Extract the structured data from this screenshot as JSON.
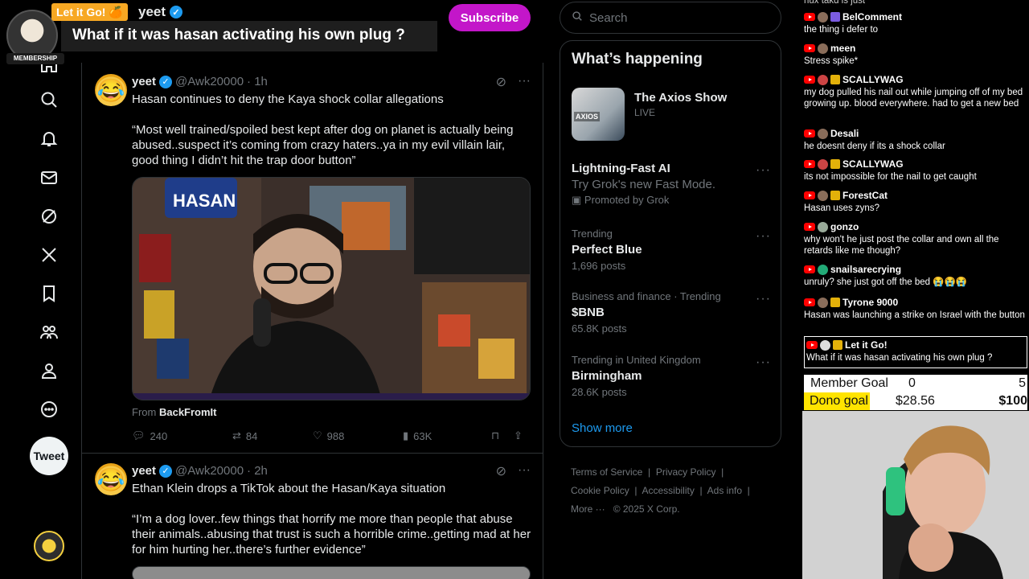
{
  "overlay": {
    "donor_tag": "Let it Go! 🍊",
    "membership_label": "MEMBERSHIP",
    "top_account": "yeet",
    "caption": "What if it was hasan activating his own plug ?",
    "subscribe_label": "Subscribe"
  },
  "nav": {
    "items": [
      "home-icon",
      "explore-icon",
      "notifications-icon",
      "messages-icon",
      "grok-icon",
      "x-premium-icon",
      "bookmarks-icon",
      "communities-icon",
      "profile-icon",
      "more-icon"
    ],
    "tweet_label": "Tweet"
  },
  "feed": {
    "tweets": [
      {
        "name": "yeet",
        "handle": "@Awk20000",
        "time": "· 1h",
        "headline": "Hasan continues to deny the Kaya shock collar allegations",
        "quote": "“Most well trained/spoiled best kept after dog on planet is actually being abused..suspect it’s coming from crazy haters..ya in my evil villain lair, good thing I didn’t hit the trap door button”",
        "from_prefix": "From",
        "from_source": "BackFromIt",
        "replies": "240",
        "retweets": "84",
        "likes": "988",
        "views": "63K",
        "media_sign": "HASAN"
      },
      {
        "name": "yeet",
        "handle": "@Awk20000",
        "time": "· 2h",
        "headline": "Ethan Klein drops a TikTok about the Hasan/Kaya situation",
        "quote": "“I’m a dog lover..few things that horrify me more than people that abuse their animals..abusing that trust is such a horrible crime..getting mad at her for him hurting her..there’s further evidence”"
      }
    ]
  },
  "sidebar": {
    "search_placeholder": "Search",
    "happening_title": "What’s happening",
    "live": {
      "title": "The Axios Show",
      "status": "LIVE",
      "thumb_text": "AXIOS"
    },
    "promo": {
      "title": "Lightning-Fast AI",
      "subtitle": "Try Grok's new Fast Mode.",
      "promoted": "Promoted by Grok"
    },
    "trends": [
      {
        "meta": "Trending",
        "name": "Perfect Blue",
        "posts": "1,696 posts"
      },
      {
        "meta": "Business and finance · Trending",
        "name": "$BNB",
        "posts": "65.8K posts"
      },
      {
        "meta": "Trending in United Kingdom",
        "name": "Birmingham",
        "posts": "28.6K posts"
      }
    ],
    "show_more": "Show more",
    "footer": {
      "terms": "Terms of Service",
      "privacy": "Privacy Policy",
      "cookie": "Cookie Policy",
      "accessibility": "Accessibility",
      "ads": "Ads info",
      "more": "More ···",
      "copyright": "© 2025 X Corp."
    }
  },
  "chat": {
    "top_fragment": "nux takd is just",
    "messages": [
      {
        "user": "BelComment",
        "text": "the thing i defer to"
      },
      {
        "user": "meen",
        "text": "Stress spike*"
      },
      {
        "user": "SCALLYWAG",
        "text": "my dog pulled his nail out while jumping off of my bed growing up. blood everywhere. had to get a new bed"
      },
      {
        "user": "Desali",
        "text": "he doesnt deny if its a shock collar"
      },
      {
        "user": "SCALLYWAG",
        "text": "its not impossible for the nail to get caught"
      },
      {
        "user": "ForestCat",
        "text": "Hasan uses zyns?"
      },
      {
        "user": "gonzo",
        "text": "why won't he just post the collar and own all the retards like me though?"
      },
      {
        "user": "snailsarecrying",
        "text": "unruly? she just got off the bed 😭😭😭"
      },
      {
        "user": "Tyrone 9000",
        "text": "Hasan was launching a strike on Israel with the button"
      },
      {
        "user": "Let it Go!",
        "text": "What if it was hasan activating his own plug ?"
      }
    ]
  },
  "goals": {
    "member_label": "Member Goal",
    "member_current": "0",
    "member_target": "5",
    "member_progress": 0.0,
    "dono_label": "Dono goal",
    "dono_current": "$28.56",
    "dono_target": "$100",
    "dono_progress": 0.2856
  },
  "colors": {
    "accent": "#1d9bf0",
    "subscribe": "#c316c9",
    "donor_tag": "#f7a823",
    "dono_fill": "#ffe400"
  }
}
